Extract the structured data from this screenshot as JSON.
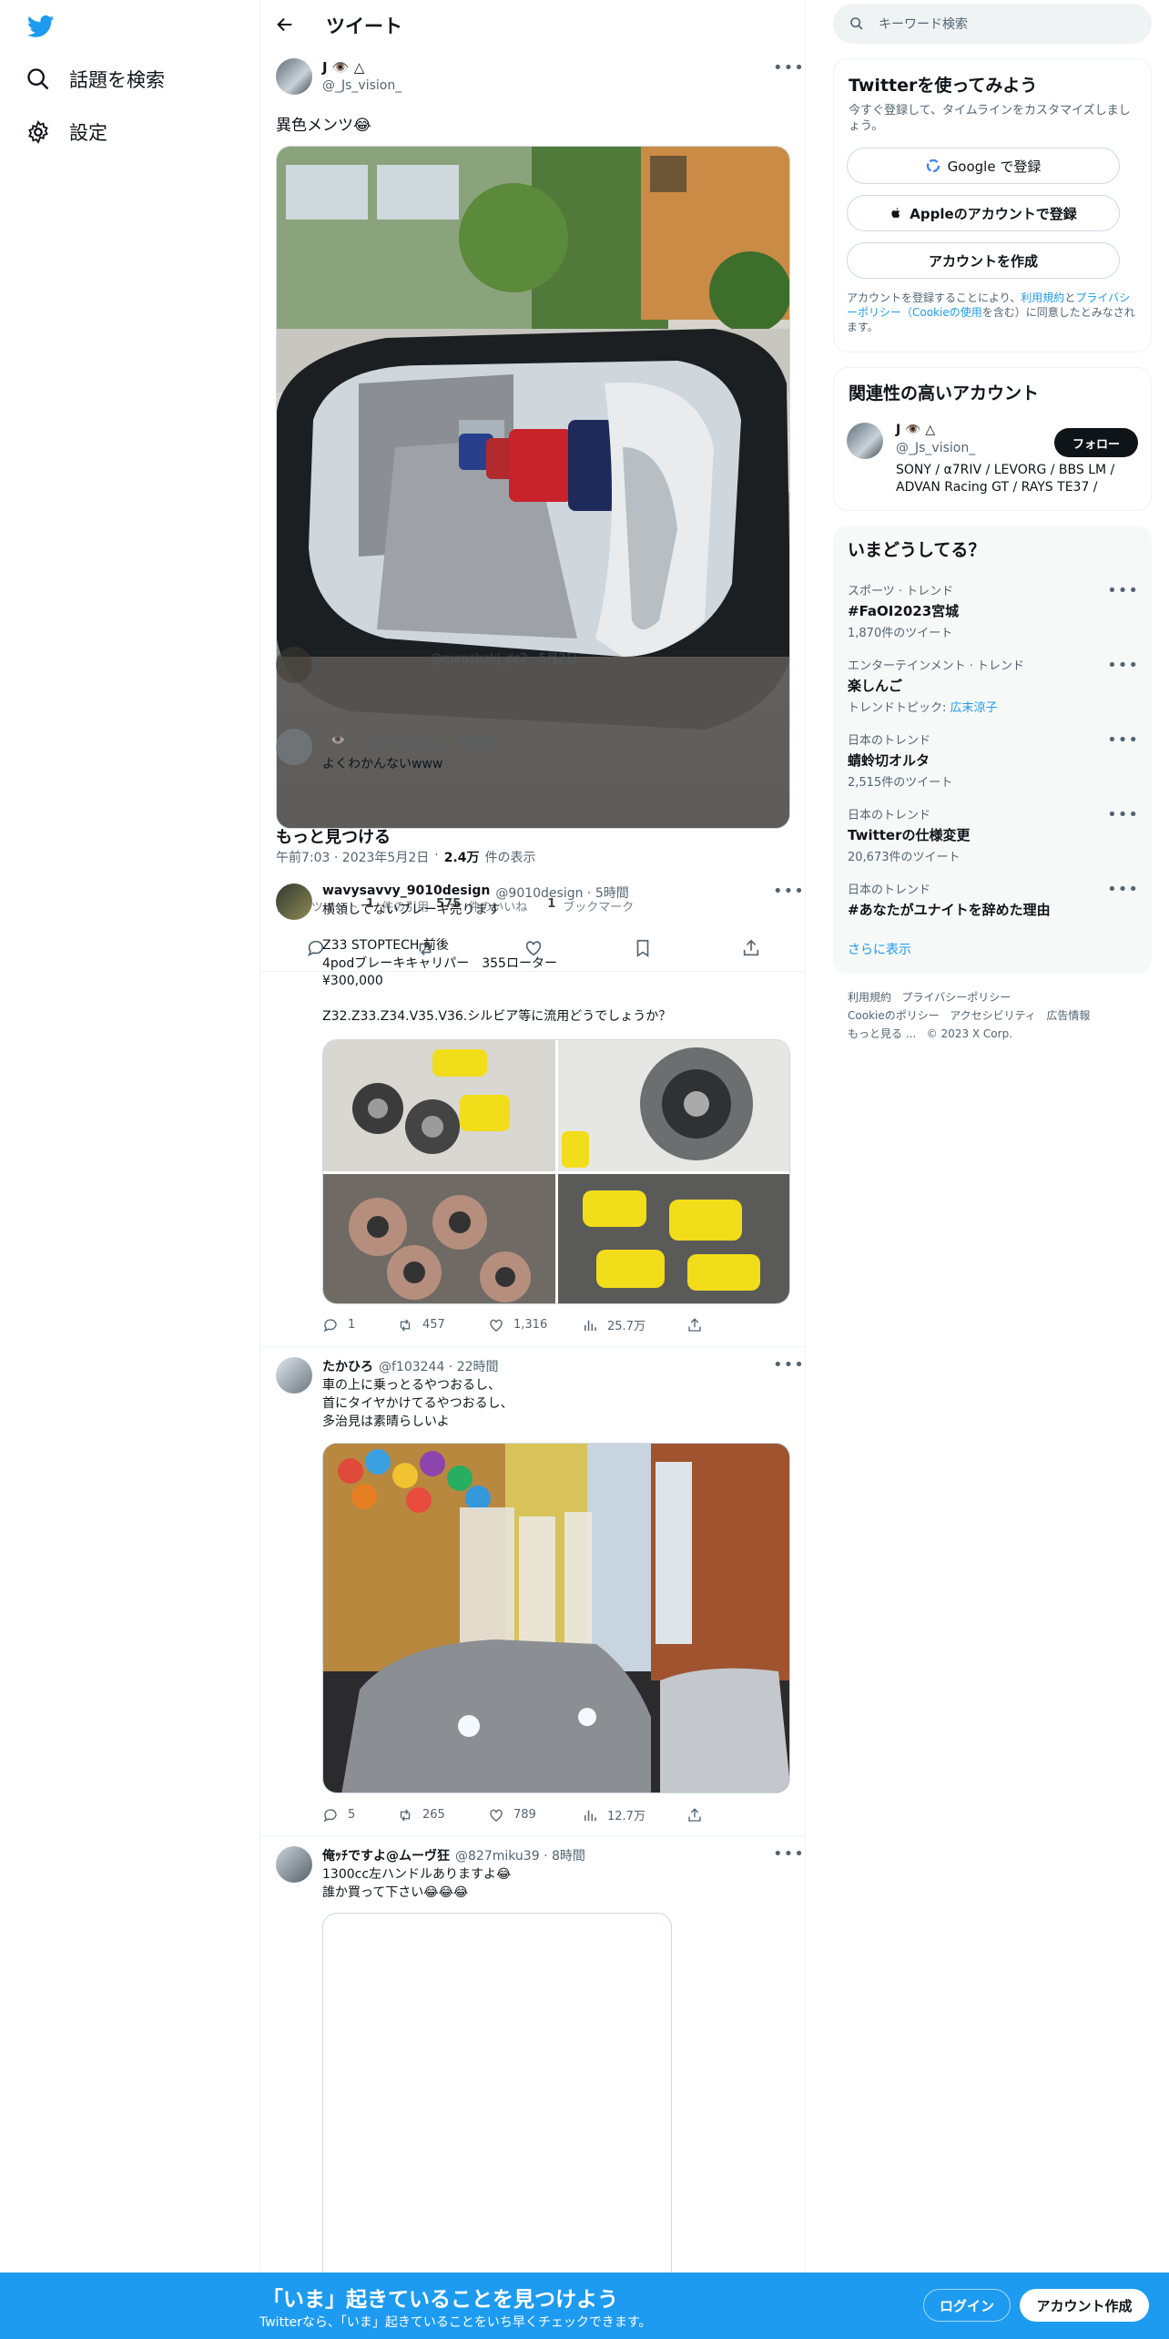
{
  "nav": {
    "explore": "話題を検索",
    "settings": "設定"
  },
  "header": {
    "title": "ツイート"
  },
  "tweet": {
    "name": "J 👁️ △",
    "handle": "@_Js_vision_",
    "text": "異色メンツ😂",
    "time": "午前7:03 · 2023年5月2日",
    "views": "2.4万",
    "views_label": "件の表示",
    "retweets": "1",
    "retweets_label": "件のリツイート",
    "quotes": "1",
    "quotes_label": "件の引用",
    "likes": "575",
    "likes_label": "件のいいね",
    "bookmarks": "1",
    "bookmarks_label": "ブックマーク",
    "overlay": {
      "reply_handle": "@menchaki_dc2 · 5月2日",
      "reply2_name": "👁️",
      "reply2_handle": "@_Js_vision_ · 5月2日",
      "reply2_text": "よくわかんないwww"
    }
  },
  "more": {
    "title": "もっと見つける"
  },
  "feed": [
    {
      "name": "wavysavvy_9010design",
      "handle": "@9010design · 5時間",
      "lines": [
        "横領してないブレーキ売ります",
        "",
        "Z33 STOPTECH 前後",
        "4podブレーキキャリパー　355ローター",
        "¥300,000",
        "",
        "Z32.Z33.Z34.V35.V36.シルビア等に流用どうでしょうか？"
      ],
      "replies": "1",
      "retweets": "457",
      "likes": "1,316",
      "views": "25.7万"
    },
    {
      "name": "たかひろ",
      "handle": "@f103244 · 22時間",
      "lines": [
        "車の上に乗っとるやつおるし、",
        "首にタイヤかけてるやつおるし、",
        "多治見は素晴らしいよ"
      ],
      "replies": "5",
      "retweets": "265",
      "likes": "789",
      "views": "12.7万"
    },
    {
      "name": "俺ｯﾁですよ@ムーヴ狂",
      "handle": "@827miku39 · 8時間",
      "lines": [
        "1300cc左ハンドルありますよ😂",
        "誰か買って下さい😂😂😂"
      ]
    }
  ],
  "search": {
    "placeholder": "キーワード検索"
  },
  "signup": {
    "title": "Twitterを使ってみよう",
    "desc": "今すぐ登録して、タイムラインをカスタマイズしましょう。",
    "google": "Google で登録",
    "apple": "Appleのアカウントで登録",
    "create": "アカウントを作成",
    "terms_pre": "アカウントを登録することにより、",
    "terms_link1": "利用規約",
    "terms_and": "と",
    "terms_link2": "プライバシーポリシー（Cookieの使用",
    "terms_post": "を含む）に同意したとみなされます。"
  },
  "related": {
    "title": "関連性の高いアカウント",
    "name": "J 👁️ △",
    "handle": "@_Js_vision_",
    "follow": "フォロー",
    "bio": "SONY / α7RIV / LEVORG / BBS LM / ADVAN Racing GT / RAYS TE37 /"
  },
  "trends": {
    "title": "いまどうしてる？",
    "items": [
      {
        "cat": "スポーツ · トレンド",
        "name": "#FaOI2023宮城",
        "cnt": "1,870件のツイート"
      },
      {
        "cat": "エンターテインメント · トレンド",
        "name": "楽しんご",
        "cnt_pre": "トレンドトピック: ",
        "cnt_link": "広末涼子"
      },
      {
        "cat": "日本のトレンド",
        "name": "蜻蛉切オルタ",
        "cnt": "2,515件のツイート"
      },
      {
        "cat": "日本のトレンド",
        "name": "Twitterの仕様変更",
        "cnt": "20,673件のツイート"
      },
      {
        "cat": "日本のトレンド",
        "name": "#あなたがユナイトを辞めた理由",
        "cnt": ""
      }
    ],
    "more": "さらに表示"
  },
  "footer": {
    "links": [
      "利用規約",
      "プライバシーポリシー",
      "Cookieのポリシー",
      "アクセシビリティ",
      "広告情報",
      "もっと見る ..."
    ],
    "copy": "© 2023 X Corp."
  },
  "bottom": {
    "title": "「いま」起きていることを見つけよう",
    "sub": "Twitterなら、「いま」起きていることをいち早くチェックできます。",
    "login": "ログイン",
    "signup": "アカウント作成"
  },
  "colors": {
    "accent": "#1d9bf0",
    "text": "#0f1419",
    "muted": "#536471"
  }
}
